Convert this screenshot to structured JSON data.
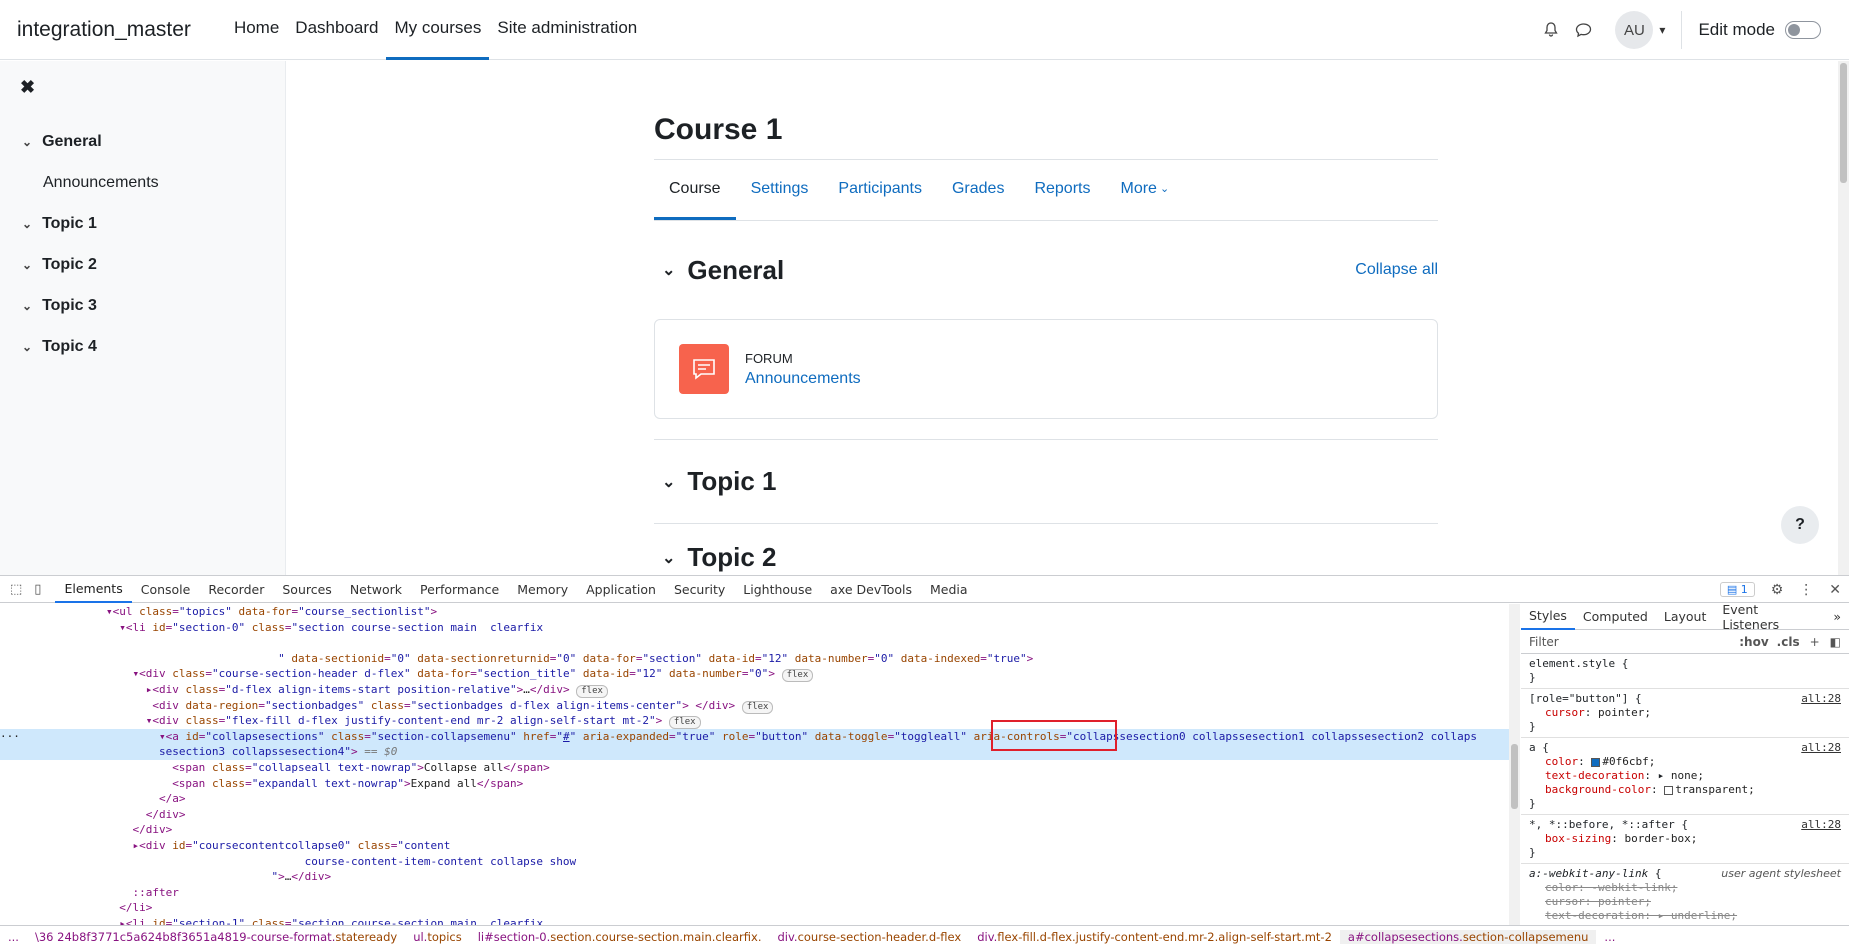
{
  "topnav": {
    "brand": "integration_master",
    "links": [
      "Home",
      "Dashboard",
      "My courses",
      "Site administration"
    ],
    "active_index": 2,
    "avatar_initials": "AU",
    "edit_mode_label": "Edit mode"
  },
  "drawer": {
    "items": [
      {
        "label": "General",
        "type": "section"
      },
      {
        "label": "Announcements",
        "type": "sub"
      },
      {
        "label": "Topic 1",
        "type": "section"
      },
      {
        "label": "Topic 2",
        "type": "section"
      },
      {
        "label": "Topic 3",
        "type": "section"
      },
      {
        "label": "Topic 4",
        "type": "section"
      }
    ]
  },
  "course": {
    "title": "Course 1",
    "tabs": [
      "Course",
      "Settings",
      "Participants",
      "Grades",
      "Reports",
      "More"
    ],
    "collapse_all": "Collapse all",
    "sections": [
      "General",
      "Topic 1",
      "Topic 2"
    ],
    "activity": {
      "type": "FORUM",
      "name": "Announcements"
    }
  },
  "help_button": "?",
  "devtools": {
    "tabs": [
      "Elements",
      "Console",
      "Recorder",
      "Sources",
      "Network",
      "Performance",
      "Memory",
      "Application",
      "Security",
      "Lighthouse",
      "axe DevTools",
      "Media"
    ],
    "issues_count": "1",
    "styles_tabs": [
      "Styles",
      "Computed",
      "Layout",
      "Event Listeners"
    ],
    "filter_placeholder": "Filter",
    "hov": ":hov",
    "cls": ".cls",
    "breadcrumbs": [
      {
        "tag": "...",
        "cls": ""
      },
      {
        "tag": "\\36 24b8f3771c5a624b8f3651a4819-course-format.",
        "cls": "stateready"
      },
      {
        "tag": "ul.",
        "cls": "topics"
      },
      {
        "tag": "li#section-0.",
        "cls": "section.course-section.main.clearfix."
      },
      {
        "tag": "div.",
        "cls": "course-section-header.d-flex"
      },
      {
        "tag": "div.",
        "cls": "flex-fill.d-flex.justify-content-end.mr-2.align-self-start.mt-2"
      },
      {
        "tag": "a#collapsesections.",
        "cls": "section-collapsemenu"
      },
      {
        "tag": "...",
        "cls": ""
      }
    ]
  },
  "colors": {
    "link": "#0f6cbf",
    "forum_icon": "#f7634d",
    "highlight": "#e0202b"
  }
}
